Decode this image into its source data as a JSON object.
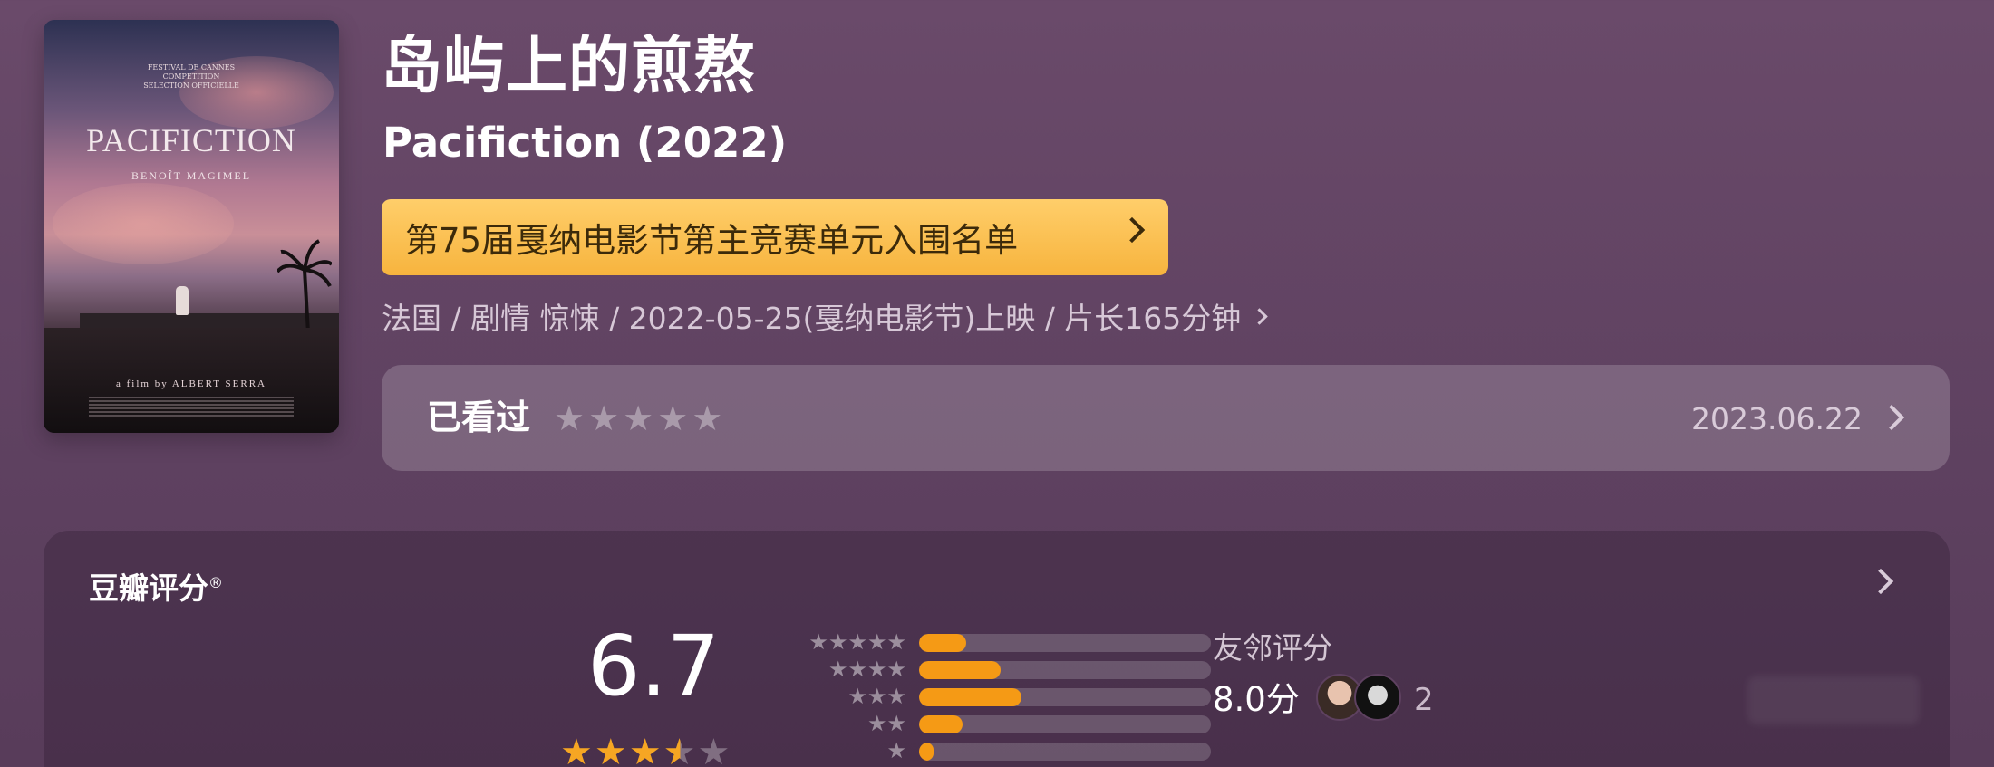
{
  "poster": {
    "festival_text": "FESTIVAL DE CANNES\nCOMPETITION\nSELECTION OFFICIELLE",
    "title": "PACIFICTION",
    "actor": "BENOÎT MAGIMEL",
    "credit": "a film by ALBERT SERRA"
  },
  "movie": {
    "title_cn": "岛屿上的煎熬",
    "title_en": "Pacifiction (2022)",
    "award": "第75届戛纳电影节第主竞赛单元入围名单",
    "meta": "法国 / 剧情 惊悚 / 2022-05-25(戛纳电影节)上映 / 片长165分钟"
  },
  "watched": {
    "label": "已看过",
    "stars": "★★★★★",
    "date": "2023.06.22"
  },
  "rating": {
    "header": "豆瓣评分",
    "header_mark": "®",
    "score": "6.7",
    "score_stars_on": "★★★",
    "score_stars_half": "★",
    "score_stars_off": "★",
    "distribution": [
      {
        "stars": "★★★★★",
        "percent": 16
      },
      {
        "stars": "★★★★",
        "percent": 28
      },
      {
        "stars": "★★★",
        "percent": 35
      },
      {
        "stars": "★★",
        "percent": 15
      },
      {
        "stars": "★",
        "percent": 5
      }
    ],
    "friend_label": "友邻评分",
    "friend_score": "8.0分",
    "friend_count": "2"
  },
  "colors": {
    "accent_orange": "#f59a15",
    "award_bg": "#f7b43e",
    "background": "#5e4160"
  }
}
